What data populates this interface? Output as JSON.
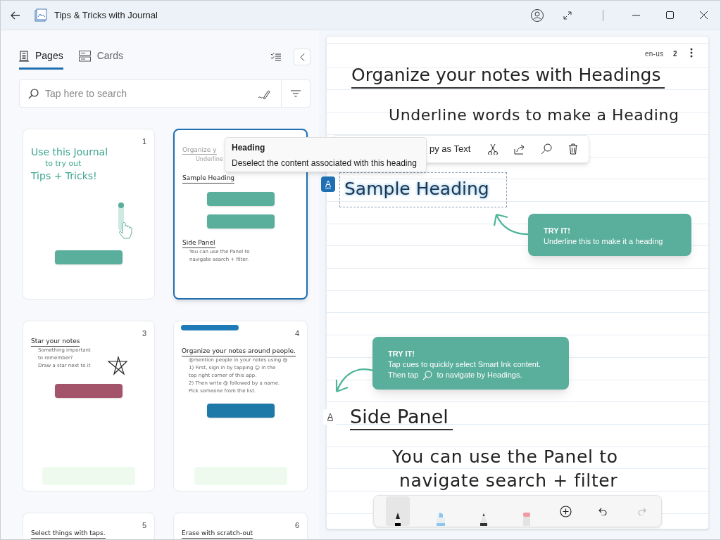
{
  "window": {
    "title": "Tips & Tricks with Journal"
  },
  "sidebar": {
    "tabs": [
      {
        "label": "Pages",
        "selected": true
      },
      {
        "label": "Cards",
        "selected": false
      }
    ],
    "search": {
      "placeholder": "Tap here to search"
    },
    "pages": [
      {
        "number": "1",
        "selected": false,
        "items": [
          {
            "kind": "green",
            "text": "Use this Journal"
          },
          {
            "kind": "green-small",
            "text": "to try out"
          },
          {
            "kind": "green",
            "text": "Tips + Tricks!"
          },
          {
            "kind": "scroll-cue"
          },
          {
            "kind": "callout",
            "color": "#5aae9c"
          }
        ]
      },
      {
        "selected": true,
        "items": [
          {
            "kind": "faint-heading",
            "text": "Organize y"
          },
          {
            "kind": "faint-line",
            "text": "Underline"
          },
          {
            "kind": "heading",
            "text": "Sample Heading"
          },
          {
            "kind": "callout",
            "color": "#5aae9c"
          },
          {
            "kind": "callout",
            "color": "#5aae9c"
          },
          {
            "kind": "heading",
            "text": "Side Panel"
          },
          {
            "kind": "line",
            "text": "You can use the Panel to"
          },
          {
            "kind": "line",
            "text": "navigate search + filter."
          }
        ]
      },
      {
        "number": "3",
        "selected": false,
        "items": [
          {
            "kind": "heading",
            "text": "Star your notes"
          },
          {
            "kind": "line",
            "text": "Something important"
          },
          {
            "kind": "line",
            "text": "to remember?"
          },
          {
            "kind": "line",
            "text": "Draw a star next to it"
          },
          {
            "kind": "star"
          },
          {
            "kind": "callout",
            "color": "#a3546a"
          },
          {
            "kind": "tip"
          }
        ]
      },
      {
        "number": "4",
        "selected": false,
        "items": [
          {
            "kind": "pill"
          },
          {
            "kind": "heading",
            "text": "Organize your notes around people."
          },
          {
            "kind": "line",
            "text": "@mention people in your notes using @"
          },
          {
            "kind": "line",
            "text": "1) First, sign in by tapping ☺ in the"
          },
          {
            "kind": "line",
            "text": "top right corner of this app."
          },
          {
            "kind": "line",
            "text": "2) Then write @ followed by a name."
          },
          {
            "kind": "line",
            "text": "Pick someone from the list."
          },
          {
            "kind": "callout",
            "color": "#1e78a8"
          },
          {
            "kind": "tip"
          }
        ]
      },
      {
        "number": "5",
        "selected": false,
        "items": [
          {
            "kind": "heading",
            "text": "Select things with taps."
          }
        ]
      },
      {
        "number": "6",
        "selected": false,
        "items": [
          {
            "kind": "heading",
            "text": "Erase with scratch-out"
          }
        ]
      }
    ]
  },
  "page": {
    "language": "en-us",
    "page_number": "2",
    "ink": [
      {
        "kind": "heading",
        "text": "Organize your notes with Headings"
      },
      {
        "kind": "line",
        "text": "Underline words to make a Heading"
      },
      {
        "kind": "selected-heading",
        "text": "Sample Heading"
      },
      {
        "kind": "heading",
        "text": "Side Panel"
      },
      {
        "kind": "line",
        "text": "You can use the Panel to"
      },
      {
        "kind": "line",
        "text": "navigate search + filter"
      }
    ],
    "heading_cues": [
      {
        "label": "A",
        "selected": true
      },
      {
        "label": "A",
        "selected": false
      }
    ],
    "callouts": [
      {
        "title": "TRY IT!",
        "lines": [
          {
            "text": "Underline this to make it a heading"
          }
        ]
      },
      {
        "title": "TRY IT!",
        "lines": [
          {
            "text": "Tap cues to quickly select Smart Ink content."
          },
          {
            "text": "Then tap",
            "after": "to navigate by Headings."
          }
        ]
      }
    ],
    "context_menu": {
      "label": "py as Text"
    },
    "tooltip": {
      "title": "Heading",
      "text": "Deselect the content associated with this heading"
    },
    "toolbar": {
      "tools": [
        {
          "kind": "pen",
          "selected": true
        },
        {
          "kind": "highlighter",
          "selected": false
        },
        {
          "kind": "pencil",
          "selected": false
        },
        {
          "kind": "eraser",
          "selected": false
        }
      ],
      "redo": {
        "disabled": true
      }
    }
  }
}
